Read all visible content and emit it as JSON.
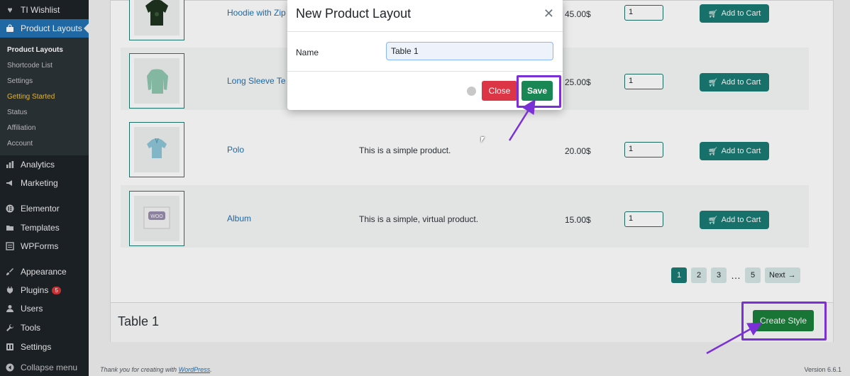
{
  "sidebar": {
    "top_items": [
      {
        "label": "TI Wishlist",
        "icon": "heart-icon"
      },
      {
        "label": "Product Layouts",
        "icon": "bag-icon"
      }
    ],
    "submenu": [
      "Product Layouts",
      "Shortcode List",
      "Settings",
      "Getting Started",
      "Status",
      "Affiliation",
      "Account"
    ],
    "items": [
      {
        "label": "Analytics",
        "icon": "bar-chart-icon"
      },
      {
        "label": "Marketing",
        "icon": "megaphone-icon"
      },
      {
        "label": "Elementor",
        "icon": "elementor-icon"
      },
      {
        "label": "Templates",
        "icon": "folder-icon"
      },
      {
        "label": "WPForms",
        "icon": "form-icon"
      },
      {
        "label": "Appearance",
        "icon": "brush-icon"
      },
      {
        "label": "Plugins",
        "icon": "plug-icon",
        "badge": "5"
      },
      {
        "label": "Users",
        "icon": "user-icon"
      },
      {
        "label": "Tools",
        "icon": "wrench-icon"
      },
      {
        "label": "Settings",
        "icon": "settings-icon"
      },
      {
        "label": "Collapse menu",
        "icon": "collapse-icon"
      }
    ]
  },
  "products": [
    {
      "name": "Hoodie with Zip",
      "description": "",
      "price": "45.00$",
      "qty": "1",
      "cart_label": "Add to Cart"
    },
    {
      "name": "Long Sleeve Te",
      "description": "",
      "price": "25.00$",
      "qty": "1",
      "cart_label": "Add to Cart"
    },
    {
      "name": "Polo",
      "description": "This is a simple product.",
      "price": "20.00$",
      "qty": "1",
      "cart_label": "Add to Cart"
    },
    {
      "name": "Album",
      "description": "This is a simple, virtual product.",
      "price": "15.00$",
      "qty": "1",
      "cart_label": "Add to Cart"
    }
  ],
  "pagination": {
    "pages": [
      "1",
      "2",
      "3",
      "…",
      "5"
    ],
    "next_label": "Next"
  },
  "table_footer": {
    "title": "Table 1",
    "create_label": "Create Style"
  },
  "footer": {
    "thanks_text": "Thank you for creating with",
    "wordpress_link": "WordPress",
    "version": "Version 6.6.1"
  },
  "modal": {
    "title": "New Product Layout",
    "name_label": "Name",
    "name_value": "Table 1",
    "close_label": "Close",
    "save_label": "Save"
  },
  "colors": {
    "accent_teal": "#1a7b73",
    "save_green": "#198754",
    "close_red": "#dc3545",
    "annotation_purple": "#7b2fd6",
    "sidebar_bg": "#1d2327",
    "active_blue": "#2271b1"
  }
}
